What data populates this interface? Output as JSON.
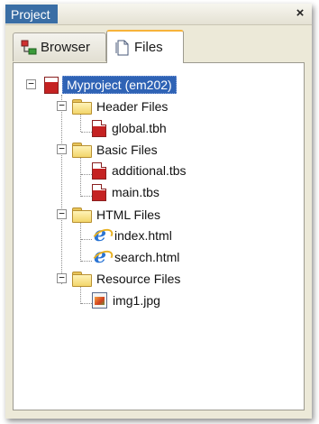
{
  "window": {
    "title": "Project",
    "close_symbol": "×"
  },
  "tabs": [
    {
      "label": "Browser",
      "icon": "browser-icon",
      "selected": false
    },
    {
      "label": "Files",
      "icon": "files-icon",
      "selected": true
    }
  ],
  "tree": {
    "root": {
      "label": "Myproject (em202)",
      "expanded": true,
      "selected": true
    },
    "groups": [
      {
        "label": "Header Files",
        "expanded": true,
        "items": [
          {
            "label": "global.tbh",
            "icon": "code-file-icon"
          }
        ]
      },
      {
        "label": "Basic Files",
        "expanded": true,
        "items": [
          {
            "label": "additional.tbs",
            "icon": "code-file-icon"
          },
          {
            "label": "main.tbs",
            "icon": "code-file-icon"
          }
        ]
      },
      {
        "label": "HTML Files",
        "expanded": true,
        "items": [
          {
            "label": "index.html",
            "icon": "ie-file-icon"
          },
          {
            "label": "search.html",
            "icon": "ie-file-icon"
          }
        ]
      },
      {
        "label": "Resource Files",
        "expanded": true,
        "items": [
          {
            "label": "img1.jpg",
            "icon": "image-file-icon"
          }
        ]
      }
    ],
    "expander_collapsed_symbol": "+",
    "expander_expanded_symbol": "−"
  },
  "colors": {
    "title_bg": "#3a6ea5",
    "selection_bg": "#2f63b5",
    "active_tab_accent": "#f7b33a"
  }
}
